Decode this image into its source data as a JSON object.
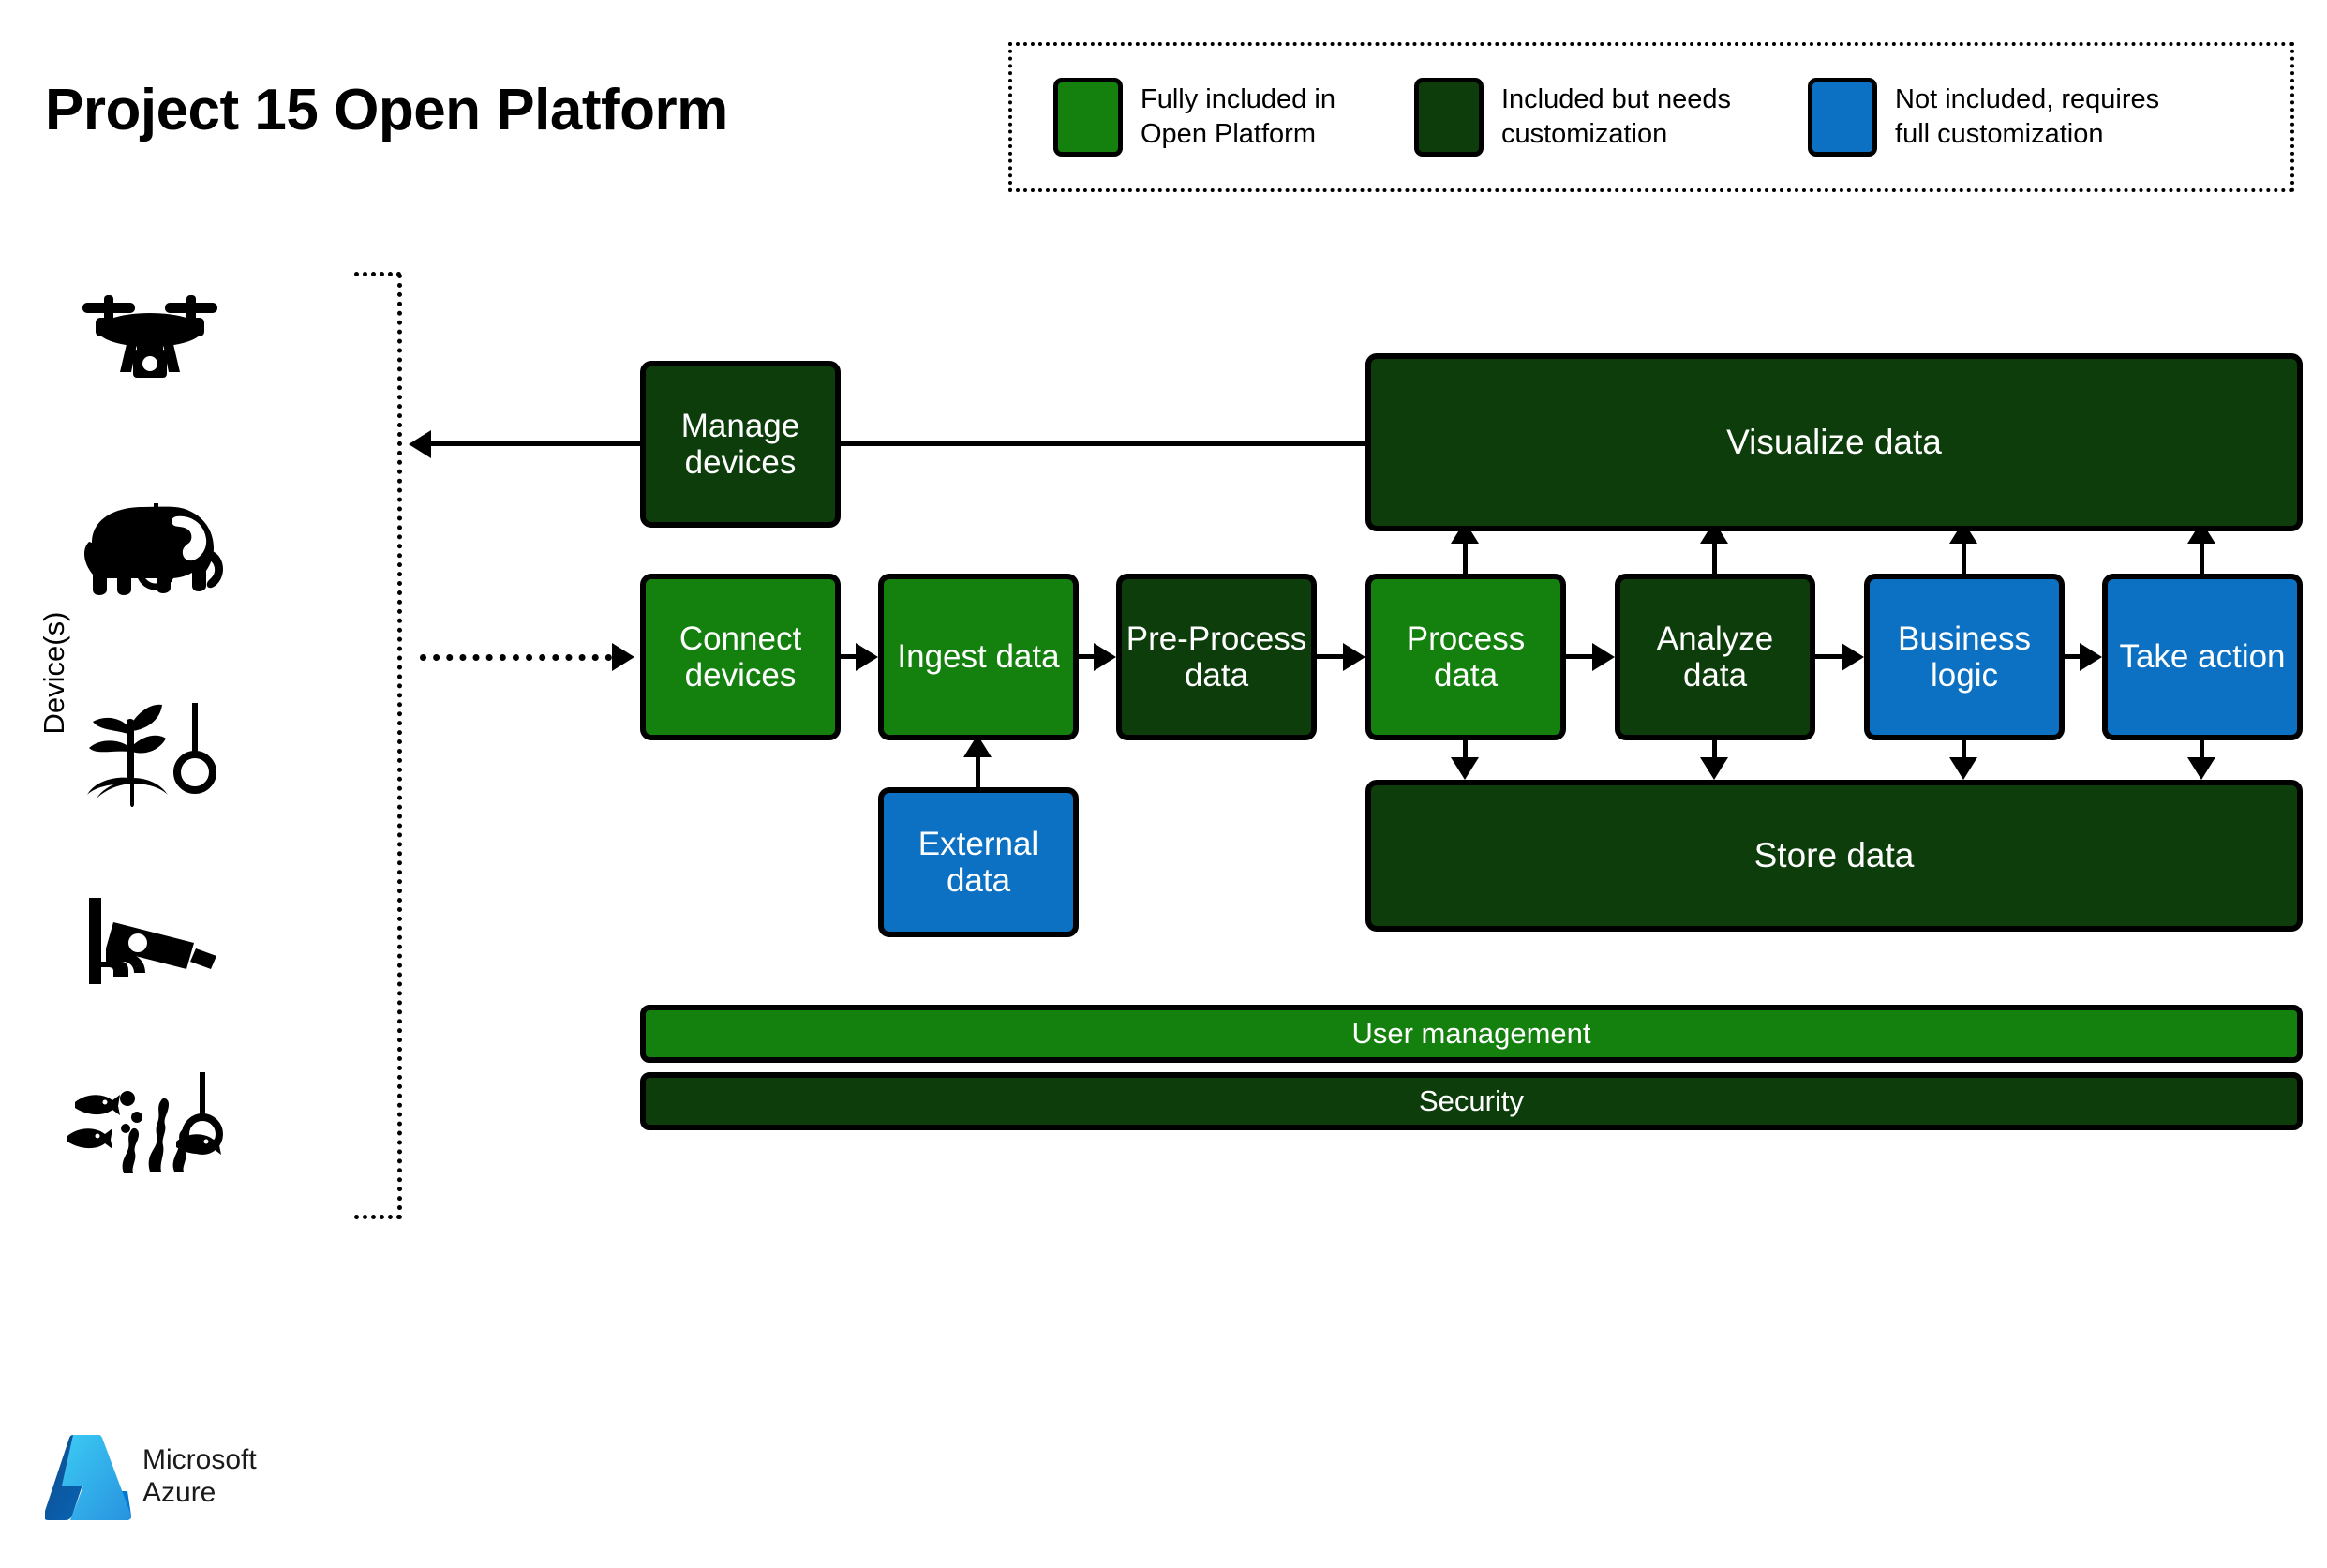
{
  "title": "Project 15 Open Platform",
  "legend": {
    "items": [
      {
        "label": "Fully included in\nOpen Platform",
        "color": "#14800E",
        "swatch_name": "legend-swatch-green"
      },
      {
        "label": "Included but needs\ncustomization",
        "color": "#0C3D0B",
        "swatch_name": "legend-swatch-dark-green"
      },
      {
        "label": "Not included, requires\nfull customization",
        "color": "#0C71C3",
        "swatch_name": "legend-swatch-blue"
      }
    ]
  },
  "devices": {
    "label": "Device(s)",
    "icons": [
      {
        "name": "drone-icon"
      },
      {
        "name": "elephant-tracker-icon"
      },
      {
        "name": "plant-sensor-icon"
      },
      {
        "name": "security-camera-icon"
      },
      {
        "name": "underwater-fish-sensor-icon"
      }
    ]
  },
  "nodes": {
    "manage_devices": "Manage devices",
    "visualize_data": "Visualize data",
    "connect_devices": "Connect devices",
    "ingest_data": "Ingest data",
    "pre_process_data": "Pre-Process data",
    "process_data": "Process data",
    "analyze_data": "Analyze data",
    "business_logic": "Business logic",
    "take_action": "Take action",
    "external_data": "External data",
    "store_data": "Store data",
    "user_management": "User management",
    "security": "Security"
  },
  "colors": {
    "green": "#14800E",
    "dark_green": "#0C3D0B",
    "blue": "#0C71C3",
    "stroke": "#000000",
    "background": "#FFFFFF"
  },
  "footer": {
    "brand": "Microsoft\nAzure",
    "logo_name": "microsoft-azure-logo"
  }
}
